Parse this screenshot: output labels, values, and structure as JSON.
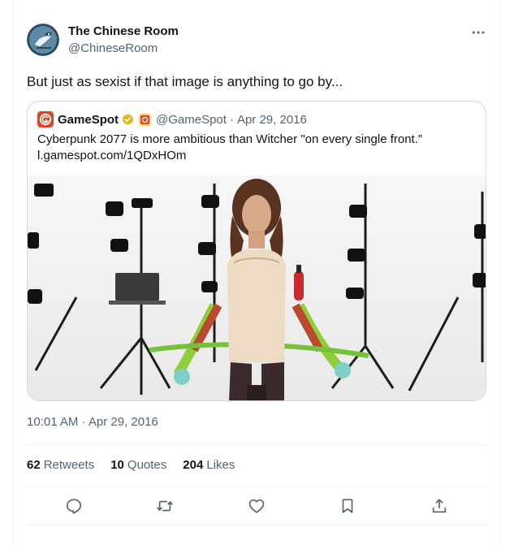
{
  "tweet": {
    "author_name": "The Chinese Room",
    "author_handle": "@ChineseRoom",
    "text": "But just as sexist if that image is anything to go by...",
    "timestamp": "10:01 AM · Apr 29, 2016"
  },
  "quoted_tweet": {
    "author_name": "GameSpot",
    "author_handle": "@GameSpot",
    "separator": "·",
    "date": "Apr 29, 2016",
    "text": "Cyberpunk 2077 is more ambitious than Witcher \"on every single front.\"",
    "link": "l.gamespot.com/1QDxHOm"
  },
  "stats": {
    "retweets_count": "62",
    "retweets_label": "Retweets",
    "quotes_count": "10",
    "quotes_label": "Quotes",
    "likes_count": "204",
    "likes_label": "Likes"
  },
  "icons": {
    "more": "more-horizontal-icon",
    "reply": "reply-icon",
    "retweet": "retweet-icon",
    "like": "heart-icon",
    "bookmark": "bookmark-icon",
    "share": "share-icon",
    "verified": "verified-badge-icon"
  },
  "colors": {
    "text_primary": "#0f1419",
    "text_secondary": "#536471",
    "border": "#cfd9de",
    "verified_gold": "#e2b719",
    "gamespot_red": "#d9472b"
  }
}
